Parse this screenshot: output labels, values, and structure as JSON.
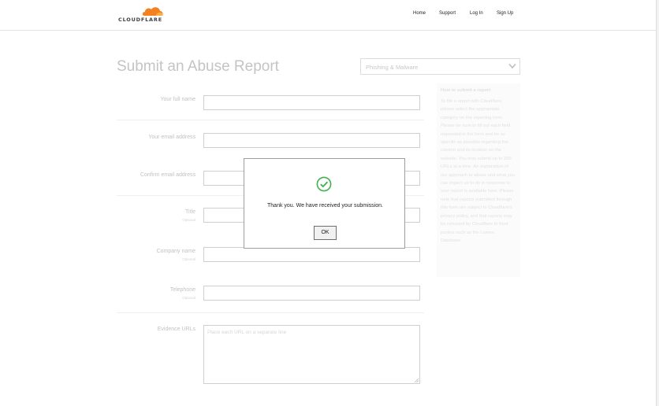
{
  "header": {
    "logo_text": "CLOUDFLARE",
    "nav": {
      "home": "Home",
      "support": "Support",
      "login": "Log In",
      "signup": "Sign Up"
    }
  },
  "form": {
    "title": "Submit an Abuse Report",
    "category": "Phishing & Malware",
    "optional_label": "Optional",
    "fields": {
      "full_name": "Your full name",
      "email": "Your email address",
      "confirm_email": "Confirm email address",
      "title": "Title",
      "company": "Company name",
      "telephone": "Telephone",
      "evidence_urls": "Evidence URLs"
    },
    "evidence_placeholder": "Place each URL on a separate line"
  },
  "sidebar": {
    "title": "How to submit a report",
    "body": "To file a report with Cloudflare, please select the appropriate category on the reporting form. Please be sure to fill out each field requested in the form and be as specific as possible regarding the content and its location on the website. You may submit up to 250 URLs at a time. An explanation of our approach to abuse and what you can expect us to do in response to your report is available here. Please note that reports submitted through this form are subject to Cloudflare's privacy policy, and that reports may be released by Cloudflare to third parties such as the Lumen Database."
  },
  "dialog": {
    "message": "Thank you. We have received your submission.",
    "ok_label": "OK"
  },
  "colors": {
    "brand_orange": "#f48120",
    "success_green": "#3fb24f"
  }
}
